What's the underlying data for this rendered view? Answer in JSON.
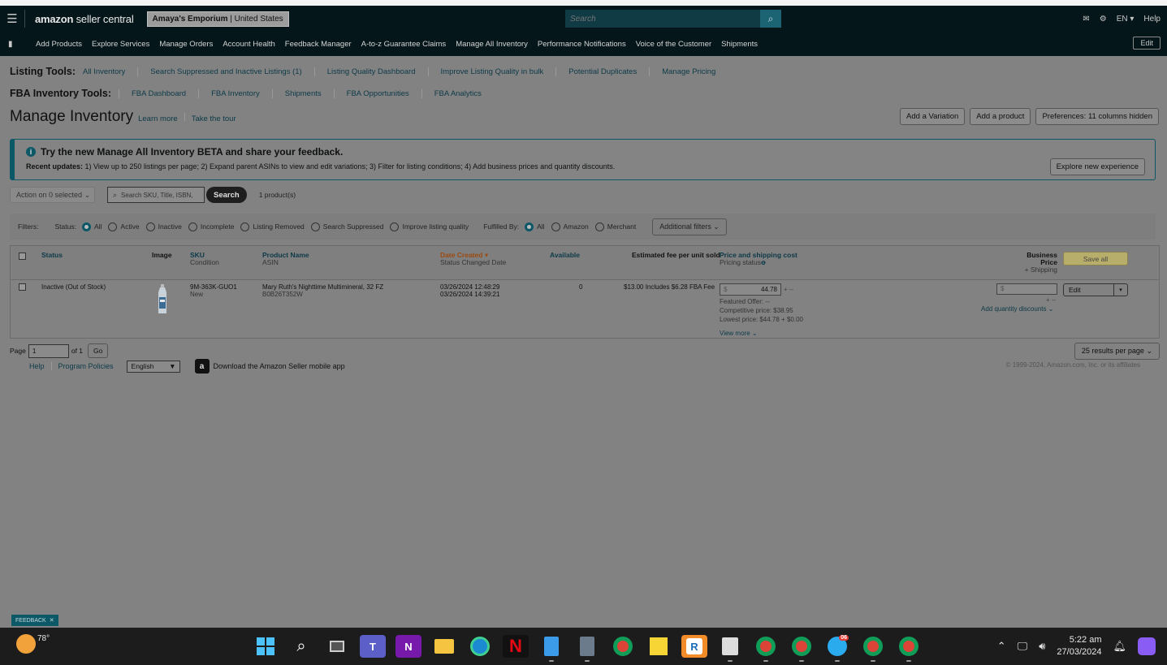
{
  "header": {
    "logo_brand": "amazon",
    "logo_rest": " seller central",
    "store_name": "Amaya's Emporium",
    "store_region": "United States",
    "search_placeholder": "Search",
    "lang": "EN",
    "help": "Help"
  },
  "nav": {
    "items": [
      "Add Products",
      "Explore Services",
      "Manage Orders",
      "Account Health",
      "Feedback Manager",
      "A-to-z Guarantee Claims",
      "Manage All Inventory",
      "Performance Notifications",
      "Voice of the Customer",
      "Shipments"
    ],
    "edit": "Edit"
  },
  "listing_tools": {
    "label": "Listing Tools:",
    "links": [
      "All Inventory",
      "Search Suppressed and Inactive Listings (1)",
      "Listing Quality Dashboard",
      "Improve Listing Quality in bulk",
      "Potential Duplicates",
      "Manage Pricing"
    ]
  },
  "fba_tools": {
    "label": "FBA Inventory Tools:",
    "links": [
      "FBA Dashboard",
      "FBA Inventory",
      "Shipments",
      "FBA Opportunities",
      "FBA Analytics"
    ]
  },
  "page": {
    "title": "Manage Inventory",
    "learn_more": "Learn more",
    "tour": "Take the tour",
    "buttons": [
      "Add a Variation",
      "Add a product",
      "Preferences: 11 columns hidden"
    ]
  },
  "banner": {
    "title": "Try the new Manage All Inventory BETA and share your feedback.",
    "updates_label": "Recent updates:",
    "updates_text": " 1) View up to 250 listings per page; 2) Expand parent ASINs to view and edit variations; 3) Filter for listing conditions; 4) Add business prices and quantity discounts.",
    "button": "Explore new experience"
  },
  "actions": {
    "action_label": "Action on 0 selected",
    "search_placeholder": "Search SKU, Title, ISBN,",
    "search_button": "Search",
    "count": "1 product(s)"
  },
  "filters": {
    "label": "Filters:",
    "status_label": "Status:",
    "status_options": [
      "All",
      "Active",
      "Inactive",
      "Incomplete",
      "Listing Removed",
      "Search Suppressed",
      "Improve listing quality"
    ],
    "fulfilled_label": "Fulfilled By:",
    "fulfilled_options": [
      "All",
      "Amazon",
      "Merchant"
    ],
    "additional": "Additional filters"
  },
  "table": {
    "headers": {
      "status": "Status",
      "image": "Image",
      "sku": "SKU",
      "condition": "Condition",
      "product_name": "Product Name",
      "asin": "ASIN",
      "date_created": "Date Created",
      "status_changed": "Status Changed Date",
      "available": "Available",
      "est_fee": "Estimated fee per unit sold",
      "price": "Price and shipping cost",
      "pricing_status": "Pricing status",
      "business_price": "Business Price",
      "plus_shipping": "+ Shipping",
      "save_all": "Save all"
    },
    "row": {
      "status": "Inactive (Out of Stock)",
      "sku": "9M-363K-GUO1",
      "condition": "New",
      "product_name": "Mary Ruth's Nighttime Multimineral, 32 FZ",
      "asin": "B0B26T352W",
      "date_created": "03/26/2024 12:48:29",
      "status_changed": "03/26/2024 14:39:21",
      "available": "0",
      "est_fee": "$13.00 Includes $6.28 FBA Fee",
      "price_currency": "$",
      "price": "44.78",
      "price_plus": "+ --",
      "featured_offer": "Featured Offer: --",
      "competitive_price": "Competitive price: $38.95",
      "lowest_price": "Lowest price: $44.78 + $0.00",
      "view_more": "View more",
      "business_currency": "$",
      "business_plus": "+ --",
      "quantity_discounts": "Add quantity discounts",
      "edit": "Edit"
    }
  },
  "pager": {
    "page_label": "Page",
    "page_value": "1",
    "of": "of 1",
    "go": "Go",
    "per_page": "25 results per page"
  },
  "footer": {
    "help": "Help",
    "program_policies": "Program Policies",
    "language": "English",
    "download_app": "Download the Amazon Seller mobile app",
    "copyright": "© 1999-2024, Amazon.com, Inc. or its affiliates"
  },
  "feedback_tab": "FEEDBACK",
  "taskbar": {
    "temperature": "78°",
    "telegram_badge": "06",
    "time": "5:22 am",
    "date": "27/03/2024"
  },
  "colors": {
    "header_bg": "#05161a",
    "accent_teal": "#0d5867",
    "dim_page": "#828282"
  }
}
